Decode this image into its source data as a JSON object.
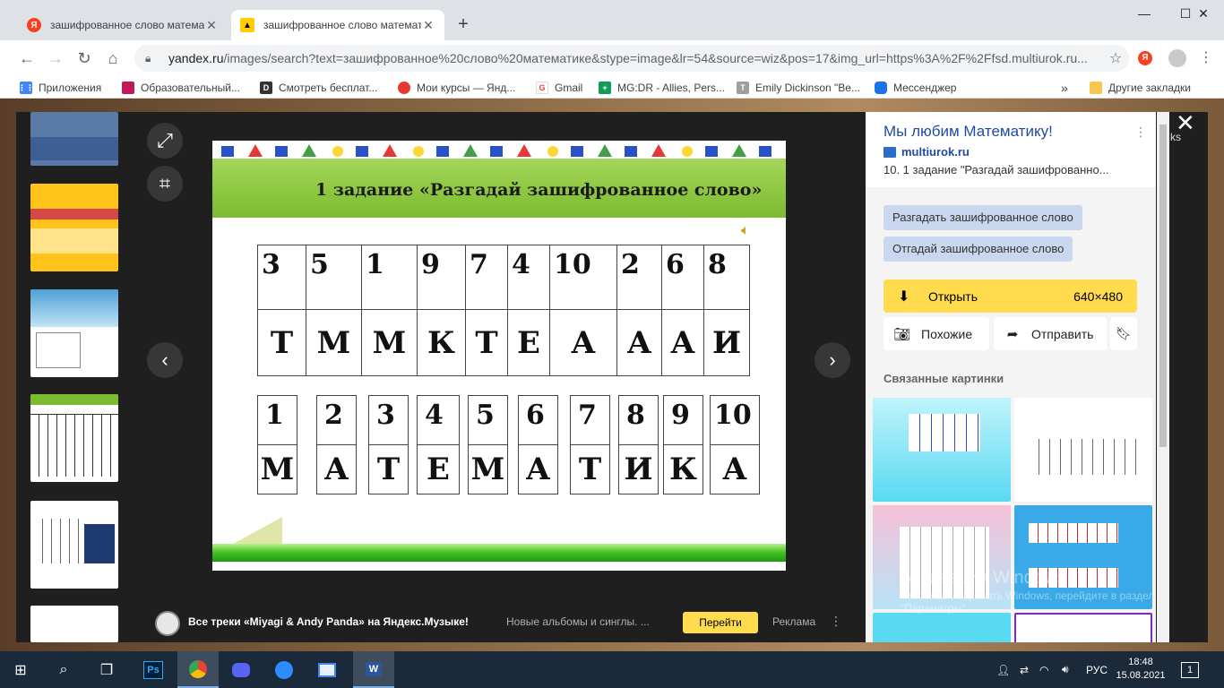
{
  "browser": {
    "tabs": [
      {
        "label": "зашифрованное слово математ",
        "favicon": "Я"
      },
      {
        "label": "зашифрованное слово математ",
        "favicon": ""
      }
    ],
    "new_tab_label": "+",
    "url_host": "yandex.ru",
    "url_path": "/images/search?text=зашифрованное%20слово%20математике&stype=image&lr=54&source=wiz&pos=17&img_url=https%3A%2F%2Ffsd.multiurok.ru...",
    "extension_label": "Я",
    "bookmarks": [
      {
        "label": "Приложения",
        "color": "#4285f4"
      },
      {
        "label": "Образовательный...",
        "color": "#c2185b"
      },
      {
        "label": "Смотреть бесплат...",
        "color": "#333333"
      },
      {
        "label": "Мои курсы — Янд...",
        "color": "#e53935"
      },
      {
        "label": "Gmail",
        "color": "#ffffff"
      },
      {
        "label": "MG:DR - Allies, Pers...",
        "color": "#0f9d58"
      },
      {
        "label": "Emily Dickinson \"Be...",
        "color": "#9e9e9e"
      },
      {
        "label": "Мессенджер",
        "color": "#1a73e8"
      }
    ],
    "bookmarks_more": "»",
    "other_bookmarks": "Другие закладки"
  },
  "slide": {
    "title": "1 задание «Разгадай зашифрованное слово»",
    "cipher_numbers": [
      "3",
      "5",
      "1",
      "9",
      "7",
      "4",
      "10",
      "2",
      "6",
      "8"
    ],
    "cipher_letters": [
      "Т",
      "М",
      "М",
      "К",
      "Т",
      "Е",
      "А",
      "А",
      "А",
      "И"
    ],
    "answer_numbers": [
      "1",
      "2",
      "3",
      "4",
      "5",
      "6",
      "7",
      "8",
      "9",
      "10"
    ],
    "answer_letters": [
      "М",
      "А",
      "Т",
      "Е",
      "М",
      "А",
      "Т",
      "И",
      "К",
      "А"
    ]
  },
  "banner": {
    "title": "Все треки «Miyagi & Andy Panda» на Яндекс.Музыке!",
    "subtitle": "Новые альбомы и синглы. ...",
    "go_label": "Перейти",
    "ad_label": "Реклама"
  },
  "panel": {
    "title": "Мы любим Математику!",
    "site": "multiurok.ru",
    "description": "10. 1 задание \"Разгадай зашифрованно...",
    "tags": [
      "Разгадать зашифрованное слово",
      "Отгадай зашифрованное слово"
    ],
    "open_label": "Открыть",
    "open_size": "640×480",
    "similar_label": "Похожие",
    "share_label": "Отправить",
    "related_label": "Связанные картинки"
  },
  "watermark": {
    "title": "Активация Windows",
    "text": "Чтобы активировать Windows, перейдите в раздел \"Параметры\"."
  },
  "side_text": "ks",
  "taskbar": {
    "lang": "РУС",
    "time": "18:48",
    "date": "15.08.2021",
    "notifications": "1"
  }
}
